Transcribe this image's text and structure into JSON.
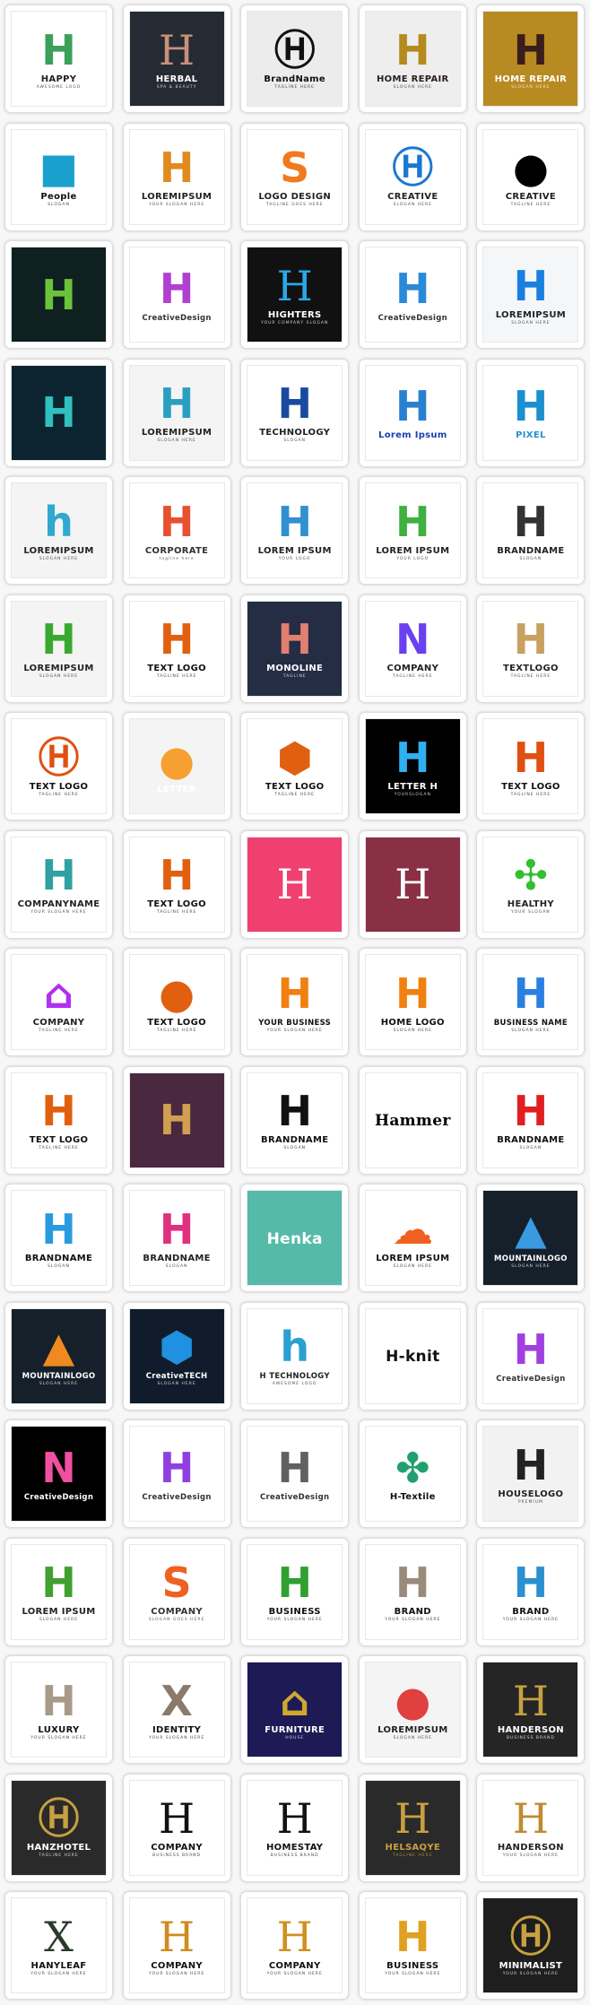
{
  "tiles": [
    {
      "title": "HAPPY",
      "tagline": "AWESOME LOGO",
      "bg": "#ffffff",
      "tc": "#222222",
      "mc": "#3aa05a",
      "mark": "H"
    },
    {
      "title": "HERBAL",
      "tagline": "SPA & BEAUTY",
      "bg": "#252a33",
      "tc": "#ffffff",
      "mc": "#c9907a",
      "mark": "H",
      "serif": true
    },
    {
      "title": "BrandName",
      "tagline": "TAGLINE HERE",
      "bg": "#ececec",
      "tc": "#111111",
      "mc": "#111111",
      "mark": "Ⓗ"
    },
    {
      "title": "HOME REPAIR",
      "tagline": "SLOGAN HERE",
      "bg": "#eeeeee",
      "tc": "#2a1f1f",
      "mc": "#b58a1e",
      "mark": "H"
    },
    {
      "title": "HOME REPAIR",
      "tagline": "SLOGAN HERE",
      "bg": "#b88a22",
      "tc": "#ffffff",
      "mc": "#3a1d1d",
      "mark": "H"
    },
    {
      "title": "People",
      "tagline": "SLOGAN",
      "bg": "#ffffff",
      "tc": "#111111",
      "mc": "#1aa0cc",
      "mark": "■"
    },
    {
      "title": "LOREMIPSUM",
      "tagline": "YOUR SLOGAN HERE",
      "bg": "#ffffff",
      "tc": "#222222",
      "mc": "#e08a20",
      "mark": "H"
    },
    {
      "title": "LOGO DESIGN",
      "tagline": "TAGLINE GOES HERE",
      "bg": "#ffffff",
      "tc": "#222222",
      "mc": "#f07a20",
      "mark": "S"
    },
    {
      "title": "CREATIVE",
      "tagline": "SLOGAN HERE",
      "bg": "#ffffff",
      "tc": "#222222",
      "mc": "#1a78d0",
      "mark": "Ⓗ"
    },
    {
      "title": "CREATIVE",
      "tagline": "TAGLINE HERE",
      "bg": "#ffffff",
      "tc": "#222222",
      "mc": "#000000",
      "mark": "●"
    },
    {
      "title": "",
      "tagline": "",
      "bg": "#0e2020",
      "tc": "#ffffff",
      "mc": "#6cc23a",
      "mark": "H"
    },
    {
      "title": "CreativeDesign",
      "tagline": "",
      "bg": "#ffffff",
      "tc": "#333333",
      "mc": "#b040d0",
      "mark": "H"
    },
    {
      "title": "HIGHTERS",
      "tagline": "YOUR COMPANY SLOGAN",
      "bg": "#111111",
      "tc": "#ffffff",
      "mc": "#2aa8e8",
      "mark": "H",
      "serif": true
    },
    {
      "title": "CreativeDesign",
      "tagline": "",
      "bg": "#ffffff",
      "tc": "#333333",
      "mc": "#2a8ad8",
      "mark": "H"
    },
    {
      "title": "LOREMIPSUM",
      "tagline": "SLOGAN HERE",
      "bg": "#f4f6f8",
      "tc": "#222222",
      "mc": "#1a80e0",
      "mark": "H"
    },
    {
      "title": "",
      "tagline": "",
      "bg": "#0c2430",
      "tc": "#ffffff",
      "mc": "#30c0c0",
      "mark": "H"
    },
    {
      "title": "LOREMIPSUM",
      "tagline": "SLOGAN HERE",
      "bg": "#f4f4f4",
      "tc": "#222222",
      "mc": "#2aa0c0",
      "mark": "H"
    },
    {
      "title": "TECHNOLOGY",
      "tagline": "SLOGAN",
      "bg": "#ffffff",
      "tc": "#222222",
      "mc": "#1a4aa0",
      "mark": "H"
    },
    {
      "title": "Lorem Ipsum",
      "tagline": "",
      "bg": "#ffffff",
      "tc": "#1a40b0",
      "mc": "#2a80d0",
      "mark": "H"
    },
    {
      "title": "PIXEL",
      "tagline": "",
      "bg": "#ffffff",
      "tc": "#2a90d0",
      "mc": "#1a90d0",
      "mark": "H"
    },
    {
      "title": "LOREMIPSUM",
      "tagline": "SLOGAN HERE",
      "bg": "#f4f4f4",
      "tc": "#222222",
      "mc": "#30a8d0",
      "mark": "h"
    },
    {
      "title": "CORPORATE",
      "tagline": "tagline here",
      "bg": "#ffffff",
      "tc": "#333333",
      "mc": "#e85030",
      "mark": "H"
    },
    {
      "title": "LOREM IPSUM",
      "tagline": "YOUR LOGO",
      "bg": "#ffffff",
      "tc": "#222222",
      "mc": "#3090d0",
      "mark": "H"
    },
    {
      "title": "LOREM IPSUM",
      "tagline": "YOUR LOGO",
      "bg": "#ffffff",
      "tc": "#222222",
      "mc": "#40b040",
      "mark": "H"
    },
    {
      "title": "BRANDNAME",
      "tagline": "SLOGAN",
      "bg": "#ffffff",
      "tc": "#222222",
      "mc": "#333333",
      "mark": "H"
    },
    {
      "title": "LOREMIPSUM",
      "tagline": "SLOGAN HERE",
      "bg": "#f4f4f4",
      "tc": "#222222",
      "mc": "#3aa830",
      "mark": "H"
    },
    {
      "title": "TEXT LOGO",
      "tagline": "TAGLINE HERE",
      "bg": "#ffffff",
      "tc": "#111111",
      "mc": "#e06010",
      "mark": "H"
    },
    {
      "title": "MONOLINE",
      "tagline": "TAGLINE",
      "bg": "#252d45",
      "tc": "#ffffff",
      "mc": "#e08070",
      "mark": "H"
    },
    {
      "title": "COMPANY",
      "tagline": "TAGLINE HERE",
      "bg": "#ffffff",
      "tc": "#222222",
      "mc": "#6a40f0",
      "mark": "N"
    },
    {
      "title": "TEXTLOGO",
      "tagline": "TAGLINE HERE",
      "bg": "#ffffff",
      "tc": "#222222",
      "mc": "#c8a060",
      "mark": "H"
    },
    {
      "title": "TEXT LOGO",
      "tagline": "TAGLINE HERE",
      "bg": "#ffffff",
      "tc": "#111111",
      "mc": "#e05010",
      "mark": "Ⓗ"
    },
    {
      "title": "LETTER",
      "tagline": "",
      "bg": "#f4f4f4",
      "tc": "#ffffff",
      "mc": "#f5a030",
      "mark": "●"
    },
    {
      "title": "TEXT LOGO",
      "tagline": "TAGLINE HERE",
      "bg": "#ffffff",
      "tc": "#111111",
      "mc": "#e06010",
      "mark": "⬢"
    },
    {
      "title": "LETTER H",
      "tagline": "YOURSLOGAN",
      "bg": "#000000",
      "tc": "#ffffff",
      "mc": "#30b0f0",
      "mark": "H"
    },
    {
      "title": "TEXT LOGO",
      "tagline": "TAGLINE HERE",
      "bg": "#ffffff",
      "tc": "#111111",
      "mc": "#e05010",
      "mark": "H"
    },
    {
      "title": "COMPANYNAME",
      "tagline": "YOUR SLOGAN HERE",
      "bg": "#ffffff",
      "tc": "#222222",
      "mc": "#30a0a0",
      "mark": "H"
    },
    {
      "title": "TEXT LOGO",
      "tagline": "TAGLINE HERE",
      "bg": "#ffffff",
      "tc": "#111111",
      "mc": "#e06010",
      "mark": "H"
    },
    {
      "title": "",
      "tagline": "",
      "bg": "#f04070",
      "tc": "#ffffff",
      "mc": "#ffffff",
      "mark": "H",
      "serif": true
    },
    {
      "title": "",
      "tagline": "",
      "bg": "#8a3045",
      "tc": "#ffffff",
      "mc": "#ffffff",
      "mark": "H",
      "serif": true
    },
    {
      "title": "HEALTHY",
      "tagline": "YOUR SLOGAN",
      "bg": "#ffffff",
      "tc": "#222222",
      "mc": "#30c030",
      "mark": "✣"
    },
    {
      "title": "COMPANY",
      "tagline": "TAGLINE HERE",
      "bg": "#ffffff",
      "tc": "#222222",
      "mc": "#b030f0",
      "mark": "⌂"
    },
    {
      "title": "TEXT LOGO",
      "tagline": "TAGLINE HERE",
      "bg": "#ffffff",
      "tc": "#111111",
      "mc": "#e06010",
      "mark": "●"
    },
    {
      "title": "YOUR BUSINESS",
      "tagline": "YOUR SLOGAN HERE",
      "bg": "#ffffff",
      "tc": "#111111",
      "mc": "#f08010",
      "mark": "H"
    },
    {
      "title": "HOME LOGO",
      "tagline": "SLOGAN HERE",
      "bg": "#ffffff",
      "tc": "#111111",
      "mc": "#f08010",
      "mark": "H"
    },
    {
      "title": "BUSINESS NAME",
      "tagline": "SLOGAN HERE",
      "bg": "#ffffff",
      "tc": "#111111",
      "mc": "#2a80e0",
      "mark": "H"
    },
    {
      "title": "TEXT LOGO",
      "tagline": "TAGLINE HERE",
      "bg": "#ffffff",
      "tc": "#111111",
      "mc": "#e06010",
      "mark": "H"
    },
    {
      "title": "",
      "tagline": "",
      "bg": "#4a2840",
      "tc": "#ffffff",
      "mc": "#d0a050",
      "mark": "H"
    },
    {
      "title": "BRANDNAME",
      "tagline": "SLOGAN",
      "bg": "#ffffff",
      "tc": "#111111",
      "mc": "#111111",
      "mark": "H"
    },
    {
      "title": "Hammer",
      "tagline": "",
      "bg": "#ffffff",
      "tc": "#000000",
      "mc": "#ffffff",
      "mark": "",
      "serif": true
    },
    {
      "title": "BRANDNAME",
      "tagline": "SLOGAN",
      "bg": "#ffffff",
      "tc": "#111111",
      "mc": "#e02020",
      "mark": "H"
    },
    {
      "title": "BRANDNAME",
      "tagline": "SLOGAN",
      "bg": "#ffffff",
      "tc": "#111111",
      "mc": "#2a9ae0",
      "mark": "H"
    },
    {
      "title": "BRANDNAME",
      "tagline": "SLOGAN",
      "bg": "#ffffff",
      "tc": "#222222",
      "mc": "#e03080",
      "mark": "H"
    },
    {
      "title": "Henka",
      "tagline": "",
      "bg": "#55bba8",
      "tc": "#ffffff",
      "mc": "#ffffff",
      "mark": ""
    },
    {
      "title": "LOREM IPSUM",
      "tagline": "SLOGAN HERE",
      "bg": "#ffffff",
      "tc": "#111111",
      "mc": "#f06020",
      "mark": "☁"
    },
    {
      "title": "MOUNTAINLOGO",
      "tagline": "SLOGAN HERE",
      "bg": "#15202a",
      "tc": "#ffffff",
      "mc": "#3a9ae0",
      "mark": "▲"
    },
    {
      "title": "MOUNTAINLOGO",
      "tagline": "SLOGAN HERE",
      "bg": "#15202a",
      "tc": "#ffffff",
      "mc": "#f08a20",
      "mark": "▲"
    },
    {
      "title": "CreativeTECH",
      "tagline": "SLOGAN HERE",
      "bg": "#101c2c",
      "tc": "#ffffff",
      "mc": "#2090e0",
      "mark": "⬢"
    },
    {
      "title": "H TECHNOLOGY",
      "tagline": "AWESOME LOGO",
      "bg": "#ffffff",
      "tc": "#222222",
      "mc": "#2aa0d0",
      "mark": "h"
    },
    {
      "title": "H-knit",
      "tagline": "",
      "bg": "#ffffff",
      "tc": "#111111",
      "mc": "#1a60e0",
      "mark": ""
    },
    {
      "title": "CreativeDesign",
      "tagline": "",
      "bg": "#ffffff",
      "tc": "#333333",
      "mc": "#a040e0",
      "mark": "H"
    },
    {
      "title": "CreativeDesign",
      "tagline": "",
      "bg": "#000000",
      "tc": "#ffffff",
      "mc": "#f050a0",
      "mark": "N"
    },
    {
      "title": "CreativeDesign",
      "tagline": "",
      "bg": "#ffffff",
      "tc": "#333333",
      "mc": "#9040e0",
      "mark": "H"
    },
    {
      "title": "CreativeDesign",
      "tagline": "",
      "bg": "#ffffff",
      "tc": "#333333",
      "mc": "#606060",
      "mark": "H"
    },
    {
      "title": "H-Textile",
      "tagline": "",
      "bg": "#ffffff",
      "tc": "#111111",
      "mc": "#20a070",
      "mark": "✤"
    },
    {
      "title": "HOUSELOGO",
      "tagline": "PREMIUM",
      "bg": "#f2f2f2",
      "tc": "#222222",
      "mc": "#222222",
      "mark": "H"
    },
    {
      "title": "LOREM IPSUM",
      "tagline": "SLOGAN HERE",
      "bg": "#ffffff",
      "tc": "#222222",
      "mc": "#40a030",
      "mark": "H"
    },
    {
      "title": "COMPANY",
      "tagline": "SLOGAN GOES HERE",
      "bg": "#ffffff",
      "tc": "#333333",
      "mc": "#f06020",
      "mark": "S"
    },
    {
      "title": "BUSINESS",
      "tagline": "YOUR SLOGAN HERE",
      "bg": "#ffffff",
      "tc": "#111111",
      "mc": "#30a030",
      "mark": "H"
    },
    {
      "title": "BRAND",
      "tagline": "YOUR SLOGAN HERE",
      "bg": "#ffffff",
      "tc": "#111111",
      "mc": "#9a8a7a",
      "mark": "H"
    },
    {
      "title": "BRAND",
      "tagline": "YOUR SLOGAN HERE",
      "bg": "#ffffff",
      "tc": "#111111",
      "mc": "#2a90d0",
      "mark": "H"
    },
    {
      "title": "LUXURY",
      "tagline": "YOUR SLOGAN HERE",
      "bg": "#ffffff",
      "tc": "#111111",
      "mc": "#a89a88",
      "mark": "H"
    },
    {
      "title": "IDENTITY",
      "tagline": "YOUR SLOGAN HERE",
      "bg": "#ffffff",
      "tc": "#111111",
      "mc": "#8a7a6a",
      "mark": "X"
    },
    {
      "title": "FURNITURE",
      "tagline": "HOUSE",
      "bg": "#1e1a55",
      "tc": "#ffffff",
      "mc": "#d0a830",
      "mark": "⌂"
    },
    {
      "title": "LOREMIPSUM",
      "tagline": "SLOGAN HERE",
      "bg": "#f4f4f4",
      "tc": "#222222",
      "mc": "#e04040",
      "mark": "●"
    },
    {
      "title": "HANDERSON",
      "tagline": "BUSINESS BRAND",
      "bg": "#252525",
      "tc": "#ffffff",
      "mc": "#c8a040",
      "mark": "H",
      "serif": true
    },
    {
      "title": "HANZHOTEL",
      "tagline": "TAGLINE HERE",
      "bg": "#2a2a2a",
      "tc": "#ffffff",
      "mc": "#c8a040",
      "mark": "Ⓗ"
    },
    {
      "title": "COMPANY",
      "tagline": "BUSINESS BRAND",
      "bg": "#ffffff",
      "tc": "#111111",
      "mc": "#111111",
      "mark": "H",
      "serif": true
    },
    {
      "title": "HOMESTAY",
      "tagline": "BUSINESS BRAND",
      "bg": "#ffffff",
      "tc": "#111111",
      "mc": "#111111",
      "mark": "H",
      "serif": true
    },
    {
      "title": "HELSAQYE",
      "tagline": "TAGLINE HERE",
      "bg": "#2a2a2a",
      "tc": "#c8a040",
      "mc": "#c8a040",
      "mark": "H",
      "serif": true
    },
    {
      "title": "HANDERSON",
      "tagline": "YOUR SLOGAN HERE",
      "bg": "#ffffff",
      "tc": "#222222",
      "mc": "#c08a30",
      "mark": "H",
      "serif": true
    },
    {
      "title": "HANYLEAF",
      "tagline": "YOUR SLOGAN HERE",
      "bg": "#ffffff",
      "tc": "#111111",
      "mc": "#2a3a2a",
      "mark": "X",
      "serif": true
    },
    {
      "title": "COMPANY",
      "tagline": "YOUR SLOGAN HERE",
      "bg": "#ffffff",
      "tc": "#111111",
      "mc": "#d08a20",
      "mark": "H",
      "serif": true
    },
    {
      "title": "COMPANY",
      "tagline": "YOUR SLOGAN HERE",
      "bg": "#ffffff",
      "tc": "#111111",
      "mc": "#d09020",
      "mark": "H",
      "serif": true
    },
    {
      "title": "BUSINESS",
      "tagline": "YOUR SLOGAN HERE",
      "bg": "#ffffff",
      "tc": "#111111",
      "mc": "#e0a020",
      "mark": "H"
    },
    {
      "title": "MINIMALIST",
      "tagline": "YOUR SLOGAN HERE",
      "bg": "#1e1e1e",
      "tc": "#ffffff",
      "mc": "#c8a040",
      "mark": "Ⓗ"
    }
  ]
}
